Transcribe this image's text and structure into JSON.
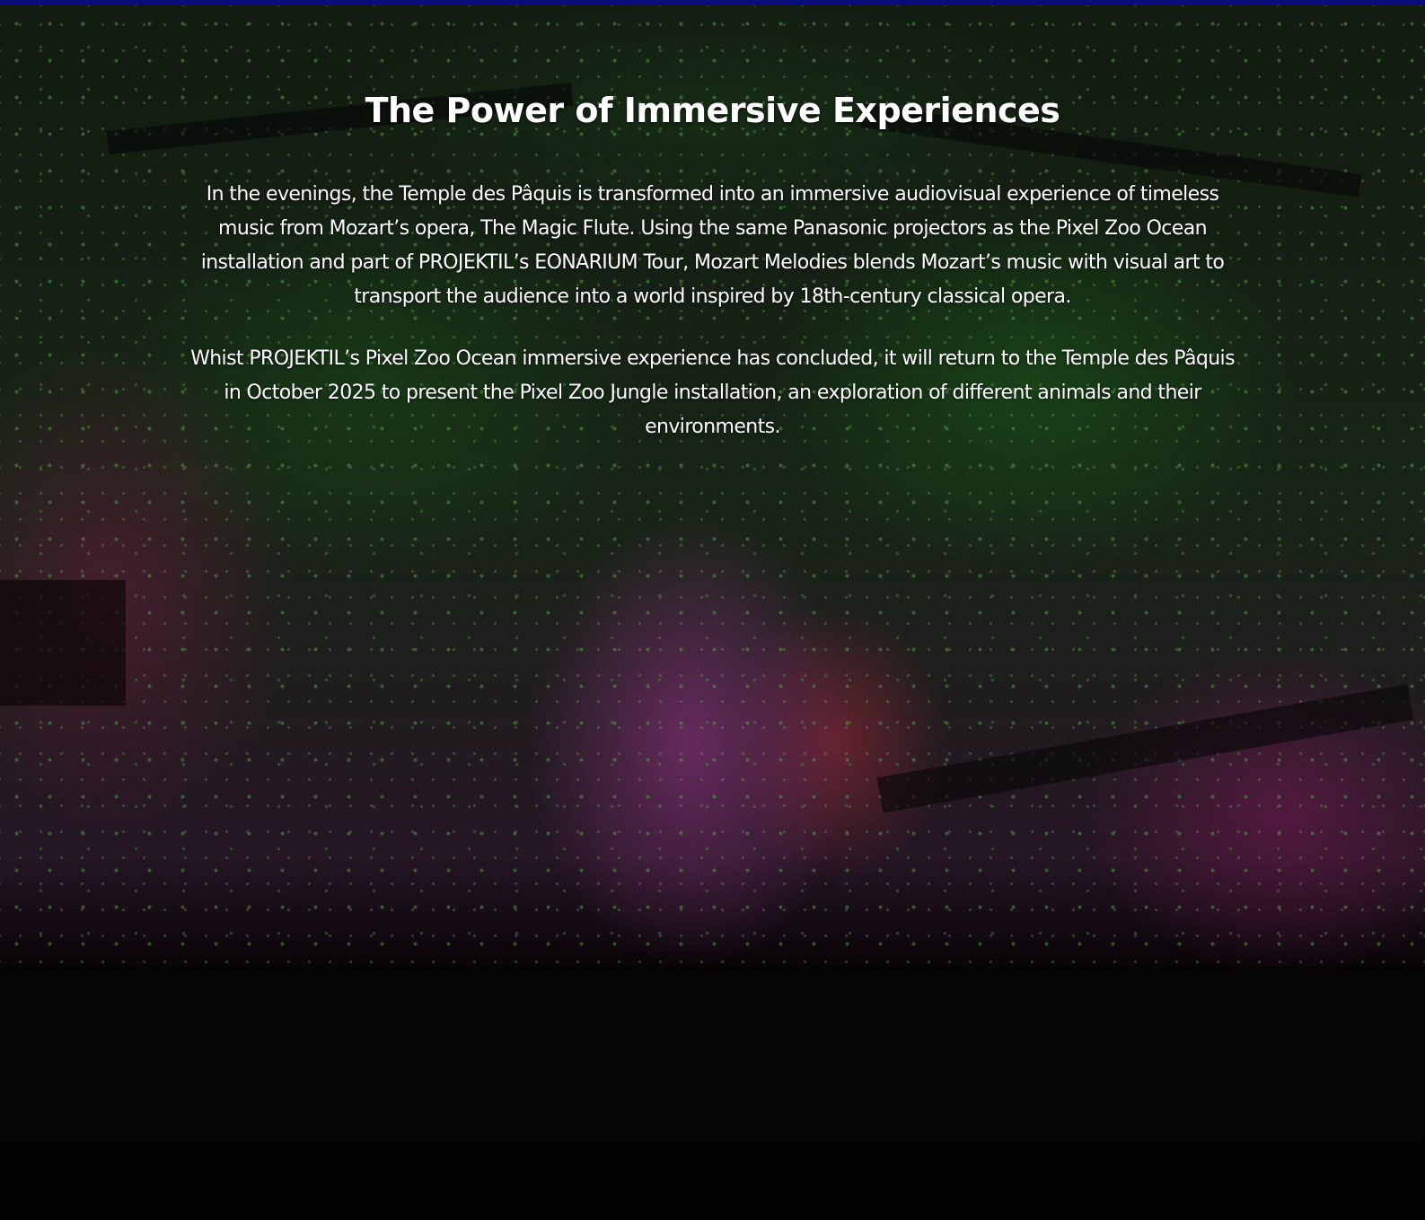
{
  "section": {
    "heading": "The Power of Immersive Experiences",
    "paragraphs": [
      "In the evenings, the Temple des Pâquis is transformed into an immersive audiovisual experience of timeless music from Mozart’s opera, The Magic Flute. Using the same Panasonic projectors as the Pixel Zoo Ocean installation and part of PROJEKTIL’s EONARIUM Tour, Mozart Melodies blends Mozart’s music with visual art to transport the audience into a world inspired by 18th-century classical opera.",
      "Whist PROJEKTIL’s Pixel Zoo Ocean immersive experience has concluded, it will return to the Temple des Pâquis in October 2025 to present the Pixel Zoo Jungle installation, an exploration of different animals and their environments."
    ]
  },
  "colors": {
    "top_bar": "#0b0b7a",
    "text": "#ffffff"
  }
}
